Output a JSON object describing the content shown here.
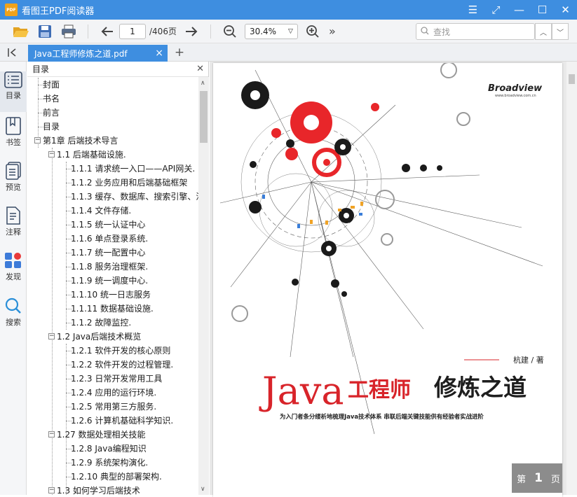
{
  "app": {
    "logo_text": "PDF",
    "title": "看图王PDF阅读器"
  },
  "toolbar": {
    "page_current": "1",
    "page_total": "/406页",
    "zoom": "30.4%",
    "more": "»",
    "search_placeholder": "查找"
  },
  "tab": {
    "title": "Java工程师修炼之道.pdf"
  },
  "leftnav": {
    "items": [
      "目录",
      "书签",
      "预览",
      "注释",
      "发现",
      "搜索"
    ]
  },
  "toc": {
    "header": "目录",
    "items": [
      {
        "label": "封面"
      },
      {
        "label": "书名"
      },
      {
        "label": "前言"
      },
      {
        "label": "目录"
      },
      {
        "label": "第1章  后端技术导言"
      },
      {
        "label": "1.1  后端基础设施."
      },
      {
        "label": "1.1.1  请求统一入口——API网关."
      },
      {
        "label": "1.1.2  业务应用和后端基础框架"
      },
      {
        "label": "1.1.3  缓存、数据库、搜索引擎、消"
      },
      {
        "label": "1.1.4  文件存储."
      },
      {
        "label": "1.1.5  统一认证中心"
      },
      {
        "label": "1.1.6  单点登录系统."
      },
      {
        "label": "1.1.7  统一配置中心"
      },
      {
        "label": "1.1.8  服务治理框架."
      },
      {
        "label": "1.1.9  统一调度中心."
      },
      {
        "label": "1.1.10  统一日志服务"
      },
      {
        "label": "1.1.11  数据基础设施."
      },
      {
        "label": "1.1.2  故障监控."
      },
      {
        "label": "1.2  Java后端技术概览"
      },
      {
        "label": "1.2.1  软件开发的核心原则"
      },
      {
        "label": "1.2.2  软件开发的过程管理."
      },
      {
        "label": "1.2.3  日常开发常用工具"
      },
      {
        "label": "1.2.4  应用的运行环境."
      },
      {
        "label": "1.2.5  常用第三方服务."
      },
      {
        "label": "1.2.6  计算机基础科学知识."
      },
      {
        "label": "1.27  数据处理相关技能"
      },
      {
        "label": "1.2.8  Java编程知识"
      },
      {
        "label": "1.2.9  系统架构演化."
      },
      {
        "label": "1.2.10  典型的部署架构."
      },
      {
        "label": "1.3  如何学习后端技术"
      }
    ]
  },
  "book": {
    "publisher": "Broadview",
    "publisher_url": "www.broadview.com.cn",
    "author": "杭建 / 著",
    "title_latin": "Java",
    "title_red": "工程师",
    "title_black": "修炼之道",
    "subtitle": "为入门者条分缕析地梳理Java技术体系   串联后端关键技能供有经验者实战进阶"
  },
  "page_badge": {
    "prefix": "第",
    "number": "1",
    "suffix": "页"
  },
  "colors": {
    "accent": "#3e8ee0",
    "title_red": "#d8242a",
    "gear_red": "#e8262a"
  }
}
